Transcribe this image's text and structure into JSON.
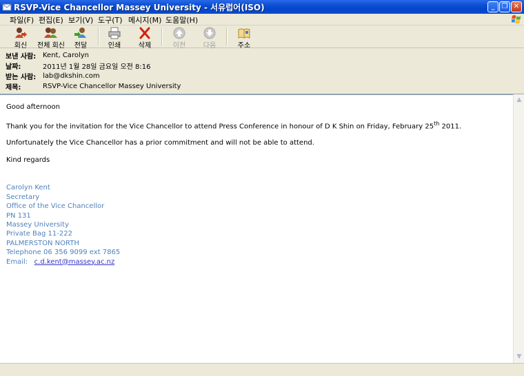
{
  "window": {
    "title": "RSVP-Vice Chancellor Massey University - 서유럽어(ISO)",
    "minimize": "_",
    "maximize": "❐",
    "close": "✕"
  },
  "menu": {
    "items": [
      "파일(F)",
      "편집(E)",
      "보기(V)",
      "도구(T)",
      "메시지(M)",
      "도움말(H)"
    ]
  },
  "toolbar": {
    "reply": "회신",
    "reply_all": "전체 회신",
    "forward": "전달",
    "print": "인쇄",
    "delete": "삭제",
    "previous": "이전",
    "next": "다음",
    "addresses": "주소"
  },
  "header": {
    "from_label": "보낸 사람:",
    "from_value": "Kent, Carolyn",
    "date_label": "날짜:",
    "date_value": "2011년 1월 28일 금요일 오전 8:16",
    "to_label": "받는 사람:",
    "to_value": "lab@dkshin.com",
    "subject_label": "제목:",
    "subject_value": "RSVP-Vice Chancellor Massey University"
  },
  "message": {
    "greeting": "Good afternoon",
    "para1_before": "Thank you for the invitation for the Vice Chancellor to attend Press Conference in honour of D K Shin on Friday, February 25",
    "para1_sup": "th",
    "para1_after": " 2011.",
    "para2": "Unfortunately the Vice Chancellor has a prior commitment and will not be able to attend.",
    "closing": "Kind regards",
    "signature": {
      "name": "Carolyn Kent",
      "role": "Secretary",
      "office": "Office of the Vice Chancellor",
      "pn": "PN 131",
      "university": "Massey University",
      "bag": "Private Bag 11-222",
      "city": "PALMERSTON NORTH",
      "phone": "Telephone 06 356 9099 ext 7865",
      "email_label": "Email:",
      "email": "c.d.kent@massey.ac.nz"
    }
  },
  "colors": {
    "title_blue": "#0a4ed4",
    "signature_blue": "#4f81bd",
    "link_blue": "#3333cc"
  }
}
